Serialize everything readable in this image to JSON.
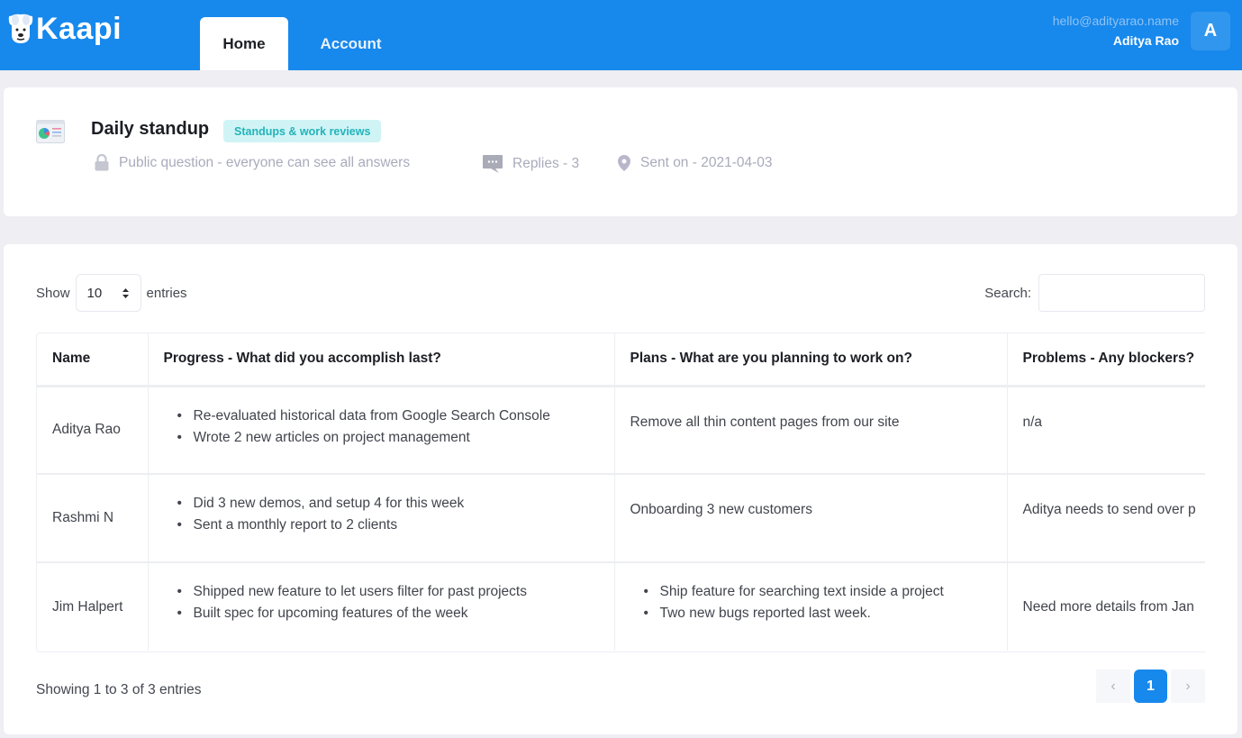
{
  "app": {
    "logo_text": "Kaapi",
    "accent_color": "#1788ec"
  },
  "nav": {
    "tabs": [
      {
        "label": "Home",
        "active": true
      },
      {
        "label": "Account",
        "active": false
      }
    ]
  },
  "user": {
    "email": "hello@adityarao.name",
    "name": "Aditya Rao",
    "avatar_initial": "A"
  },
  "question": {
    "title": "Daily standup",
    "category_badge": "Standups & work reviews",
    "visibility": "Public question - everyone can see all answers",
    "replies": "Replies - 3",
    "sent_on": "Sent on - 2021-04-03",
    "icons": {
      "question": "chart-document-icon",
      "visibility": "lock-icon",
      "replies": "chat-bubble-icon",
      "sent": "location-pin-icon"
    }
  },
  "table_controls": {
    "show_label": "Show",
    "entries_label": "entries",
    "page_size": "10",
    "search_label": "Search:",
    "search_value": ""
  },
  "table": {
    "columns": [
      "Name",
      "Progress - What did you accomplish last?",
      "Plans - What are you planning to work on?",
      "Problems - Any blockers?"
    ],
    "rows": [
      {
        "name": "Aditya Rao",
        "progress": [
          "Re-evaluated historical data from Google Search Console",
          "Wrote 2 new articles on project management"
        ],
        "plans": "Remove all thin content pages from our site",
        "problems": "n/a"
      },
      {
        "name": "Rashmi N",
        "progress": [
          "Did 3 new demos, and setup 4 for this week",
          "Sent a monthly report to 2 clients"
        ],
        "plans": "Onboarding 3 new customers",
        "problems": "Aditya needs to send over p"
      },
      {
        "name": "Jim Halpert",
        "progress": [
          "Shipped new feature to let users filter for past projects",
          "Built spec for upcoming features of the week"
        ],
        "plans": [
          "Ship feature for searching text inside a project",
          "Two new bugs reported last week."
        ],
        "problems": "Need more details from Jan"
      }
    ]
  },
  "pagination": {
    "info": "Showing 1 to 3 of 3 entries",
    "prev": "‹",
    "current": "1",
    "next": "›"
  }
}
